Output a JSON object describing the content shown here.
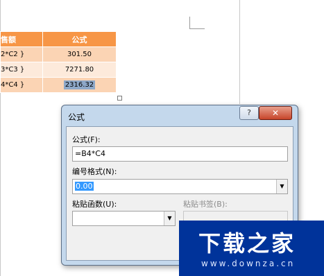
{
  "table": {
    "header": {
      "col1": "售额",
      "col2": "公式"
    },
    "rows": [
      {
        "formula": "2*C2 }",
        "value": "301.50"
      },
      {
        "formula": "3*C3 }",
        "value": "7271.80"
      },
      {
        "formula": "4*C4 }",
        "value": "2316.32"
      }
    ]
  },
  "dialog": {
    "title": "公式",
    "help_label": "?",
    "close_label": "✕",
    "formula_label": "公式(F):",
    "formula_value": "=B4*C4",
    "number_format_label": "编号格式(N):",
    "number_format_value": "0.00",
    "paste_function_label": "粘贴函数(U):",
    "paste_function_value": "",
    "paste_bookmark_label": "粘贴书签(B):",
    "paste_bookmark_value": ""
  },
  "watermark": {
    "main": "下载之家",
    "sub": "www.downza.cn"
  },
  "colors": {
    "header_bg": "#f79646",
    "row_dark": "#fbd4b4",
    "row_light": "#fdeadb",
    "watermark_bg": "#00339a"
  }
}
